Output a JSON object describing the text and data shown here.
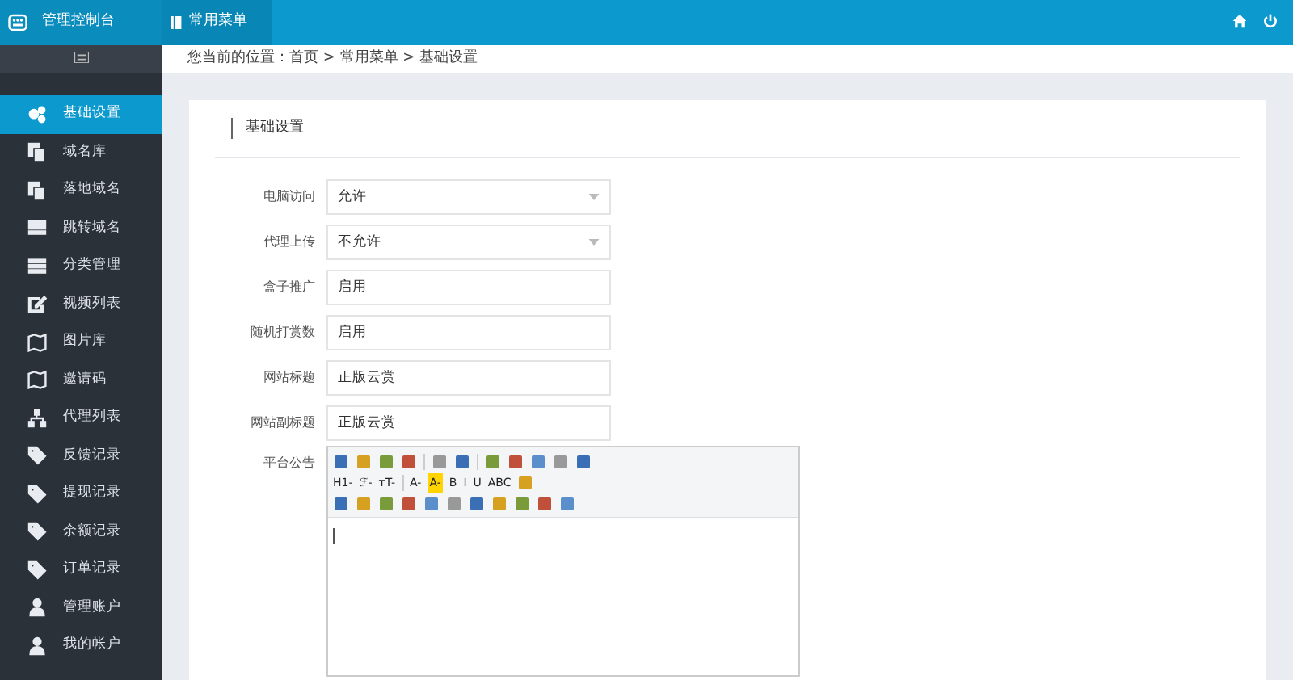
{
  "header": {
    "brand": "管理控制台",
    "tabs": [
      {
        "label": "常用菜单",
        "selected": true
      }
    ]
  },
  "sidebar": {
    "items": [
      {
        "label": "基础设置",
        "selected": true
      },
      {
        "label": "域名库",
        "selected": false
      },
      {
        "label": "落地域名",
        "selected": false
      },
      {
        "label": "跳转域名",
        "selected": false
      },
      {
        "label": "分类管理",
        "selected": false
      },
      {
        "label": "视频列表",
        "selected": false
      },
      {
        "label": "图片库",
        "selected": false
      },
      {
        "label": "邀请码",
        "selected": false
      },
      {
        "label": "代理列表",
        "selected": false
      },
      {
        "label": "反馈记录",
        "selected": false
      },
      {
        "label": "提现记录",
        "selected": false
      },
      {
        "label": "余额记录",
        "selected": false
      },
      {
        "label": "订单记录",
        "selected": false
      },
      {
        "label": "管理账户",
        "selected": false
      },
      {
        "label": "我的帐户",
        "selected": false
      }
    ]
  },
  "breadcrumb": "您当前的位置：首页 > 常用菜单 > 基础设置",
  "panel_title": "基础设置",
  "form": [
    {
      "label": "电脑访问",
      "kind": "select",
      "value": "允许"
    },
    {
      "label": "代理上传",
      "kind": "select",
      "value": "不允许"
    },
    {
      "label": "盒子推广",
      "kind": "text",
      "value": "启用"
    },
    {
      "label": "随机打赏数",
      "kind": "text",
      "value": "启用"
    },
    {
      "label": "网站标题",
      "kind": "text",
      "value": "正版云赏"
    },
    {
      "label": "网站副标题",
      "kind": "text",
      "value": "正版云赏"
    },
    {
      "label": "平台公告",
      "kind": "editor"
    }
  ],
  "editor_toolbar": [
    "H1-",
    "ℱ-",
    "тT-",
    "A-",
    "A-",
    "B",
    "I",
    "U",
    "ABC"
  ]
}
